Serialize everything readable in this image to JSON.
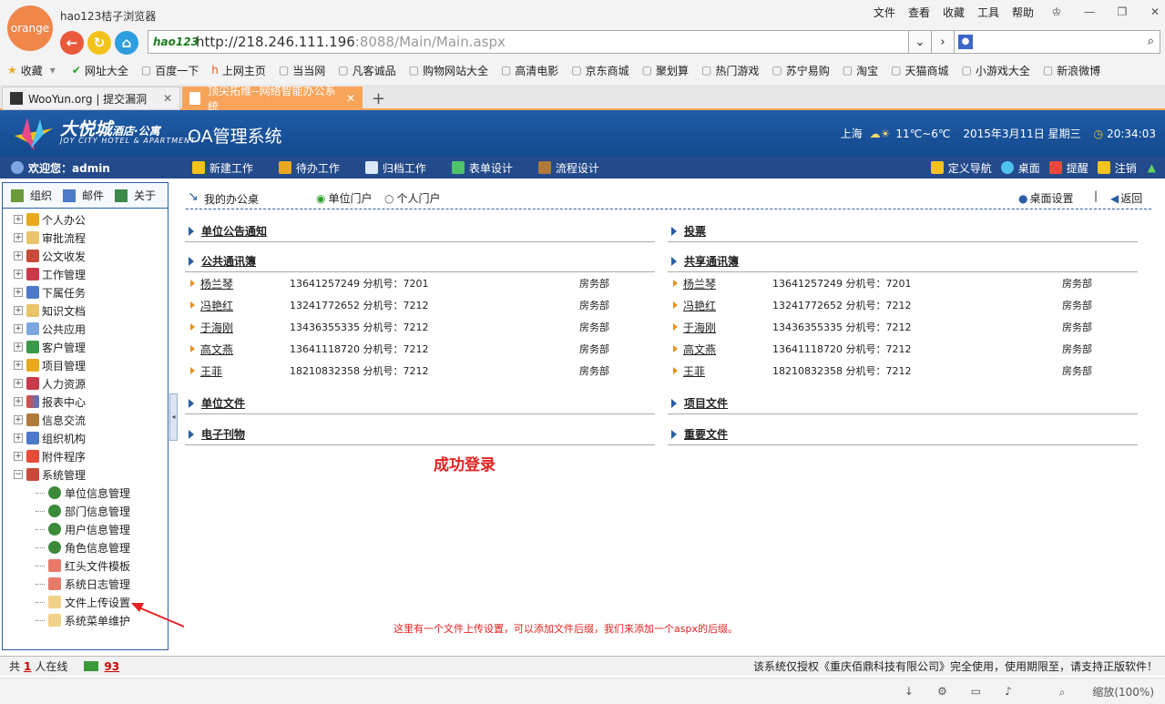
{
  "browser": {
    "logo_text": "orange",
    "title": "hao123桔子浏览器",
    "menu": [
      "文件",
      "查看",
      "收藏",
      "工具",
      "帮助"
    ],
    "addr_brand": "hao123",
    "url_host": "http://218.246.111.196",
    "url_rest": ":8088/Main/Main.aspx",
    "bookmarks": [
      "收藏",
      "网址大全",
      "百度一下",
      "上网主页",
      "当当网",
      "凡客诚品",
      "购物网站大全",
      "高清电影",
      "京东商城",
      "聚划算",
      "热门游戏",
      "苏宁易购",
      "淘宝",
      "天猫商城",
      "小游戏大全",
      "新浪微博"
    ],
    "tabs": [
      {
        "label": "WooYun.org | 提交漏洞",
        "active": false
      },
      {
        "label": "顶尖拓维--网络智能办公系统",
        "active": true
      }
    ],
    "new_tab": "+",
    "status": {
      "zoom": "缩放(100%)"
    }
  },
  "app": {
    "brand_name": "大悦城",
    "brand_name_suffix": "酒店·公寓",
    "brand_sub": "JOY CITY HOTEL & APARTMENT",
    "title": "OA管理系统",
    "weather_city": "上海",
    "weather_temp": "11℃~6℃",
    "date": "2015年3月11日  星期三",
    "time": "20:34:03"
  },
  "navbar": {
    "welcome": "欢迎您：admin",
    "items": [
      "新建工作",
      "待办工作",
      "归档工作",
      "表单设计",
      "流程设计"
    ],
    "right_items": [
      "定义导航",
      "桌面",
      "提醒",
      "注销"
    ]
  },
  "sidebar": {
    "tabs": [
      "组织",
      "邮件",
      "关于"
    ],
    "tree": [
      "个人办公",
      "审批流程",
      "公文收发",
      "工作管理",
      "下属任务",
      "知识文档",
      "公共应用",
      "客户管理",
      "项目管理",
      "人力资源",
      "报表中心",
      "信息交流",
      "组织机构",
      "附件程序",
      "系统管理"
    ],
    "children": [
      "单位信息管理",
      "部门信息管理",
      "用户信息管理",
      "角色信息管理",
      "红头文件模板",
      "系统日志管理",
      "文件上传设置",
      "系统菜单维护"
    ]
  },
  "main": {
    "desk_label": "我的办公桌",
    "radio_unit": "单位门户",
    "radio_personal": "个人门户",
    "desk_settings": "桌面设置",
    "back": "返回",
    "left_panels": [
      "单位公告通知",
      "公共通讯簿",
      "单位文件",
      "电子刊物"
    ],
    "right_panels": [
      "投票",
      "共享通讯簿",
      "项目文件",
      "重要文件"
    ],
    "contacts": [
      {
        "name": "杨兰琴",
        "phone": "13641257249 分机号：7201",
        "dept": "房务部"
      },
      {
        "name": "冯艳红",
        "phone": "13241772652 分机号：7212",
        "dept": "房务部"
      },
      {
        "name": "于海刚",
        "phone": "13436355335 分机号：7212",
        "dept": "房务部"
      },
      {
        "name": "高文燕",
        "phone": "13641118720 分机号：7212",
        "dept": "房务部"
      },
      {
        "name": "王菲",
        "phone": "18210832358 分机号：7212",
        "dept": "房务部"
      }
    ],
    "success": "成功登录",
    "annotation": "这里有一个文件上传设置，可以添加文件后缀，我们来添加一个aspx的后缀。"
  },
  "statusbar": {
    "prefix": "共",
    "online_count": "1",
    "suffix": "人在线",
    "mail_count": "93",
    "license": "该系统仅授权《重庆佰鼎科技有限公司》完全使用，使用期限至，请支持正版软件！"
  },
  "colors": {
    "accent": "#1f5ca8",
    "red": "#e52121",
    "tab_active": "#f8a35a"
  }
}
